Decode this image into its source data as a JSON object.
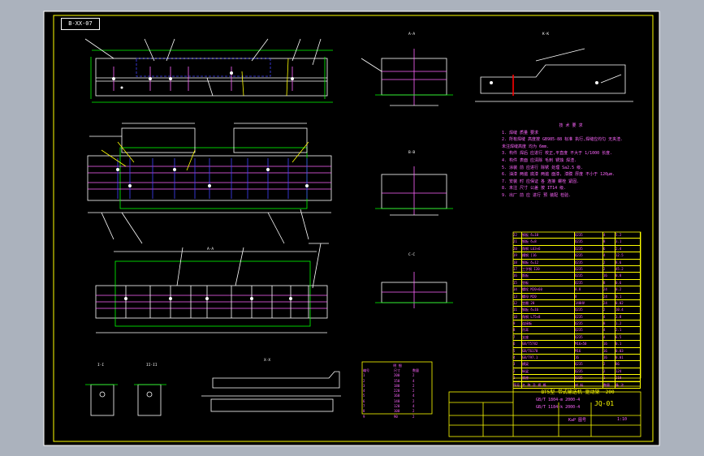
{
  "sheet_tag": "B-XX-07",
  "section_labels": {
    "view_a": "A-A",
    "view_b": "B-B",
    "view_c": "C-C",
    "view_k": "K-K",
    "view_top": "A-A",
    "view_x": "X-X",
    "detail_1": "I-I",
    "detail_2": "II-II"
  },
  "notes": {
    "title": "技 术 要 求",
    "lines": [
      "1. 焊缝 质量 要求",
      "2. 所有焊缝 高度按 GB985-88 标准 执行,焊缝应均匀 无夹渣.",
      "   未注焊缝高度 均为 6mm.",
      "3. 构件 焊后 应进行 校正,平直度 不大于 1/1000 长度.",
      "4. 构件 表面 应清除 毛刺 锈蚀 焊渣.",
      "5. 涂装 前 应进行 除锈 处理 Sa2.5 级.",
      "6. 油漆 两遍 底漆 两遍 面漆, 漆膜 厚度 不小于 120μm.",
      "7. 安装 时 应保证 各 连接 螺栓 紧固.",
      "8. 未注 尺寸 公差 按 IT14 级.",
      "9. 出厂 前 应 进行 预 装配 检验."
    ]
  },
  "bom_rows": [
    [
      "22",
      "钢板 δ=10",
      "Q235",
      "4",
      "5.2"
    ],
    [
      "21",
      "钢板 δ=8",
      "Q235",
      "8",
      "3.1"
    ],
    [
      "20",
      "角钢 L63×6",
      "Q235",
      "6",
      "2.4"
    ],
    [
      "19",
      "槽钢 [16",
      "Q235",
      "4",
      "12.5"
    ],
    [
      "18",
      "钢板 δ=12",
      "Q235",
      "2",
      "8.6"
    ],
    [
      "17",
      "工字钢 I20",
      "Q235",
      "2",
      "45.2"
    ],
    [
      "16",
      "筋板",
      "Q235",
      "16",
      "0.8"
    ],
    [
      "15",
      "垫板",
      "Q235",
      "8",
      "0.6"
    ],
    [
      "14",
      "螺栓 M20×60",
      "8.8",
      "24",
      "0.2"
    ],
    [
      "13",
      "螺母 M20",
      "8",
      "24",
      "0.1"
    ],
    [
      "12",
      "垫圈 20",
      "140HV",
      "24",
      "0.02"
    ],
    [
      "11",
      "钢板 δ=16",
      "Q235",
      "2",
      "10.4"
    ],
    [
      "10",
      "角钢 L75×8",
      "Q235",
      "4",
      "3.8"
    ],
    [
      "9",
      "连接板",
      "Q235",
      "8",
      "1.2"
    ],
    [
      "8",
      "吊耳",
      "Q235",
      "4",
      "2.1"
    ],
    [
      "7",
      "支座",
      "Q235",
      "4",
      "6.5"
    ],
    [
      "6",
      "GB/T5782",
      "M16×50",
      "16",
      "0.1"
    ],
    [
      "5",
      "GB/T6170",
      "M16",
      "16",
      "0.03"
    ],
    [
      "4",
      "GB/T97.1",
      "16",
      "16",
      "0.01"
    ],
    [
      "3",
      "横梁",
      "Q235",
      "2",
      "86"
    ],
    [
      "2",
      "纵梁",
      "Q235",
      "2",
      "124"
    ],
    [
      "1",
      "底座",
      "Q235",
      "1",
      "210"
    ]
  ],
  "bom_header": [
    "序号",
    "名 称 及 规 格",
    "材 料",
    "数量",
    "备 注"
  ],
  "title_block": {
    "title": "BT5型 带式输送机 驱动架 -200",
    "std1": "GB/T 1804-m 2000-4",
    "std2": "GB/T 1184-k 2000-4",
    "scale": "1:10",
    "drawing_no": "JQ-01",
    "weight": "K≥P 图号"
  },
  "small_table": {
    "title": "明 细",
    "rows": [
      [
        "编号",
        "尺寸",
        "数量"
      ],
      [
        "1",
        "200",
        "2"
      ],
      [
        "2",
        "150",
        "4"
      ],
      [
        "3",
        "180",
        "2"
      ],
      [
        "4",
        "220",
        "2"
      ],
      [
        "5",
        "160",
        "4"
      ],
      [
        "6",
        "140",
        "2"
      ],
      [
        "7",
        "120",
        "4"
      ],
      [
        "8",
        "100",
        "2"
      ],
      [
        "9",
        "90",
        "2"
      ]
    ]
  }
}
